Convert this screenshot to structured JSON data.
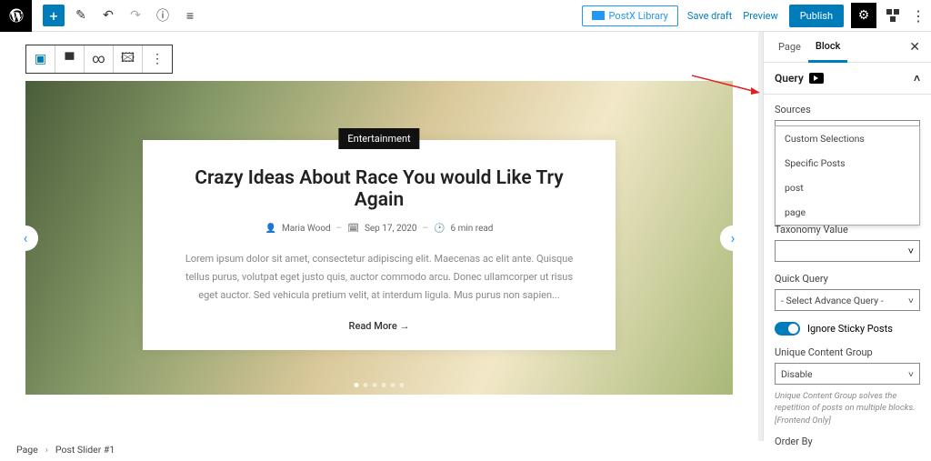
{
  "topbar": {
    "postx_label": "PostX Library",
    "save_draft": "Save draft",
    "preview": "Preview",
    "publish": "Publish"
  },
  "sidebar": {
    "tabs": {
      "page": "Page",
      "block": "Block"
    },
    "section": "Query",
    "sources_label": "Sources",
    "sources_value": "post",
    "dropdown": [
      "Custom Selections",
      "Specific Posts",
      "post",
      "page"
    ],
    "taxonomy_label": "Taxonomy Value",
    "quick_query_label": "Quick Query",
    "quick_query_value": "- Select Advance Query -",
    "ignore_sticky": "Ignore Sticky Posts",
    "ucg_label": "Unique Content Group",
    "ucg_value": "Disable",
    "ucg_help": "Unique Content Group solves the repetition of posts on multiple blocks.[Frontend Only]",
    "orderby_label": "Order By"
  },
  "slider": {
    "category": "Entertainment",
    "title": "Crazy Ideas About Race You would Like Try Again",
    "author": "Maria Wood",
    "date": "Sep 17, 2020",
    "read_time": "6 min read",
    "excerpt": "Lorem ipsum dolor sit amet, consectetur adipiscing elit. Maecenas ac elit ante. Quisque tellus purus, volutpat eget justo quis, auctor commodo arcu. Donec ullamcorper ut risus eget auctor. Sed vehicula pretium velit, at interdum ligula. Mus purus non sapien...",
    "read_more": "Read More  →"
  },
  "breadcrumb": {
    "root": "Page",
    "item": "Post Slider #1"
  }
}
